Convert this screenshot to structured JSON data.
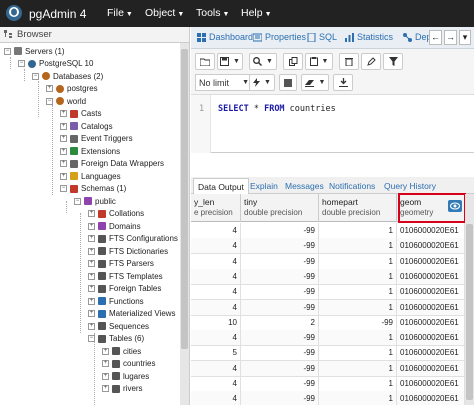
{
  "app": {
    "title": "pgAdmin 4"
  },
  "menu": [
    {
      "label": "File"
    },
    {
      "label": "Object"
    },
    {
      "label": "Tools"
    },
    {
      "label": "Help"
    }
  ],
  "browser": {
    "title": "Browser",
    "nodes": [
      {
        "label": "Servers (1)",
        "toggle": "−"
      },
      {
        "label": "PostgreSQL 10",
        "toggle": "−"
      },
      {
        "label": "Databases (2)",
        "toggle": "−"
      },
      {
        "label": "postgres",
        "toggle": "+"
      },
      {
        "label": "world",
        "toggle": "−"
      },
      {
        "label": "Casts",
        "toggle": "+"
      },
      {
        "label": "Catalogs",
        "toggle": "+"
      },
      {
        "label": "Event Triggers",
        "toggle": "+"
      },
      {
        "label": "Extensions",
        "toggle": "+"
      },
      {
        "label": "Foreign Data Wrappers",
        "toggle": "+"
      },
      {
        "label": "Languages",
        "toggle": "+"
      },
      {
        "label": "Schemas (1)",
        "toggle": "−"
      },
      {
        "label": "public",
        "toggle": "−"
      },
      {
        "label": "Collations",
        "toggle": "+"
      },
      {
        "label": "Domains",
        "toggle": "+"
      },
      {
        "label": "FTS Configurations",
        "toggle": "+"
      },
      {
        "label": "FTS Dictionaries",
        "toggle": "+"
      },
      {
        "label": "FTS Parsers",
        "toggle": "+"
      },
      {
        "label": "FTS Templates",
        "toggle": "+"
      },
      {
        "label": "Foreign Tables",
        "toggle": "+"
      },
      {
        "label": "Functions",
        "toggle": "+"
      },
      {
        "label": "Materialized Views",
        "toggle": "+"
      },
      {
        "label": "Sequences",
        "toggle": "+"
      },
      {
        "label": "Tables (6)",
        "toggle": "−"
      },
      {
        "label": "cities",
        "toggle": "+"
      },
      {
        "label": "countries",
        "toggle": "+"
      },
      {
        "label": "lugares",
        "toggle": "+"
      },
      {
        "label": "rivers",
        "toggle": "+"
      }
    ]
  },
  "tabs": [
    {
      "label": "Dashboard"
    },
    {
      "label": "Properties"
    },
    {
      "label": "SQL"
    },
    {
      "label": "Statistics"
    },
    {
      "label": "Depe"
    }
  ],
  "toolbar": {
    "limit": "No limit"
  },
  "editor": {
    "line_number": "1",
    "kw1": "SELECT",
    "star": " * ",
    "kw2": "FROM",
    "rest": " countries"
  },
  "output_tabs": [
    {
      "label": "Data Output"
    },
    {
      "label": "Explain"
    },
    {
      "label": "Messages"
    },
    {
      "label": "Notifications"
    },
    {
      "label": "Query History"
    }
  ],
  "grid": {
    "columns": [
      {
        "name": "y_len",
        "type": "e precision"
      },
      {
        "name": "tiny",
        "type": "double precision"
      },
      {
        "name": "homepart",
        "type": "double precision"
      },
      {
        "name": "geom",
        "type": "geometry"
      }
    ],
    "rows": [
      [
        "4",
        "-99",
        "1",
        "0106000020E61"
      ],
      [
        "4",
        "-99",
        "1",
        "0106000020E61"
      ],
      [
        "4",
        "-99",
        "1",
        "0106000020E61"
      ],
      [
        "4",
        "-99",
        "1",
        "0106000020E61"
      ],
      [
        "4",
        "-99",
        "1",
        "0106000020E61"
      ],
      [
        "4",
        "-99",
        "1",
        "0106000020E61"
      ],
      [
        "10",
        "2",
        "-99",
        "0106000020E61"
      ],
      [
        "4",
        "-99",
        "1",
        "0106000020E61"
      ],
      [
        "5",
        "-99",
        "1",
        "0106000020E61"
      ],
      [
        "4",
        "-99",
        "1",
        "0106000020E61"
      ],
      [
        "4",
        "-99",
        "1",
        "0106000020E61"
      ],
      [
        "4",
        "-99",
        "1",
        "0106000020E61"
      ]
    ]
  }
}
